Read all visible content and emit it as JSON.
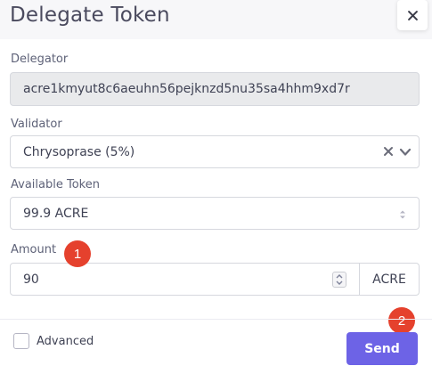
{
  "modal": {
    "title": "Delegate Token",
    "close_icon": "close-icon"
  },
  "delegator": {
    "label": "Delegator",
    "value": "acre1kmyut8c6aeuhn56pejknzd5nu35sa4hhm9xd7r"
  },
  "validator": {
    "label": "Validator",
    "selected": "Chrysoprase (5%)",
    "icons": [
      "clear-x-icon",
      "chevron-down-icon"
    ]
  },
  "available_token": {
    "label": "Available Token",
    "value": "99.9 ACRE",
    "icon": "updown-arrows-icon"
  },
  "amount": {
    "label": "Amount",
    "value": "90",
    "unit": "ACRE",
    "icon": "spinner-icon"
  },
  "badges": [
    "1",
    "2"
  ],
  "footer": {
    "advanced_label": "Advanced",
    "send_label": "Send"
  },
  "colors": {
    "primary": "#6d63e6",
    "badge": "#e5412d",
    "readonly_bg": "#e9eaec"
  }
}
